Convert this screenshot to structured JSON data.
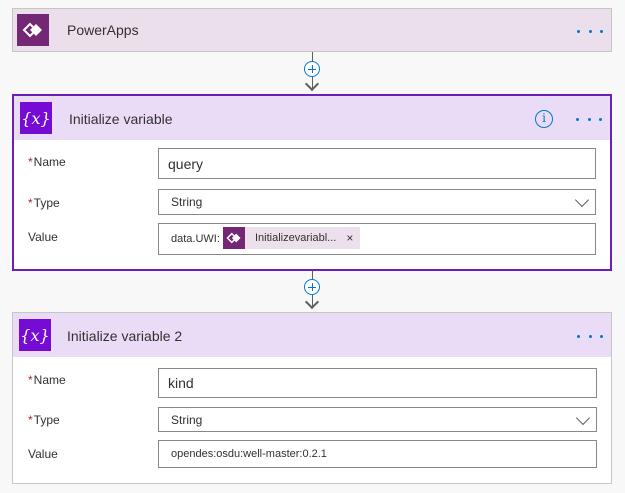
{
  "trigger": {
    "title": "PowerApps",
    "icon": "powerapps-icon"
  },
  "action1": {
    "title": "Initialize variable",
    "icon": "variable-icon",
    "info_glyph": "i",
    "fields": {
      "name": {
        "label": "Name",
        "value": "query"
      },
      "type": {
        "label": "Type",
        "value": "String"
      },
      "value": {
        "label": "Value",
        "prefix": "data.UWI:",
        "token": "Initializevariabl...",
        "token_close": "×"
      }
    }
  },
  "action2": {
    "title": "Initialize variable 2",
    "icon": "variable-icon",
    "fields": {
      "name": {
        "label": "Name",
        "value": "kind"
      },
      "type": {
        "label": "Type",
        "value": "String"
      },
      "value": {
        "label": "Value",
        "value": "opendes:osdu:well-master:0.2.1"
      }
    }
  },
  "required_marker": "*",
  "variable_glyph": "{x}",
  "colors": {
    "powerapps": "#742774",
    "variable": "#770bd6",
    "accent": "#0078d4",
    "selected_border": "#6c1fb8"
  }
}
